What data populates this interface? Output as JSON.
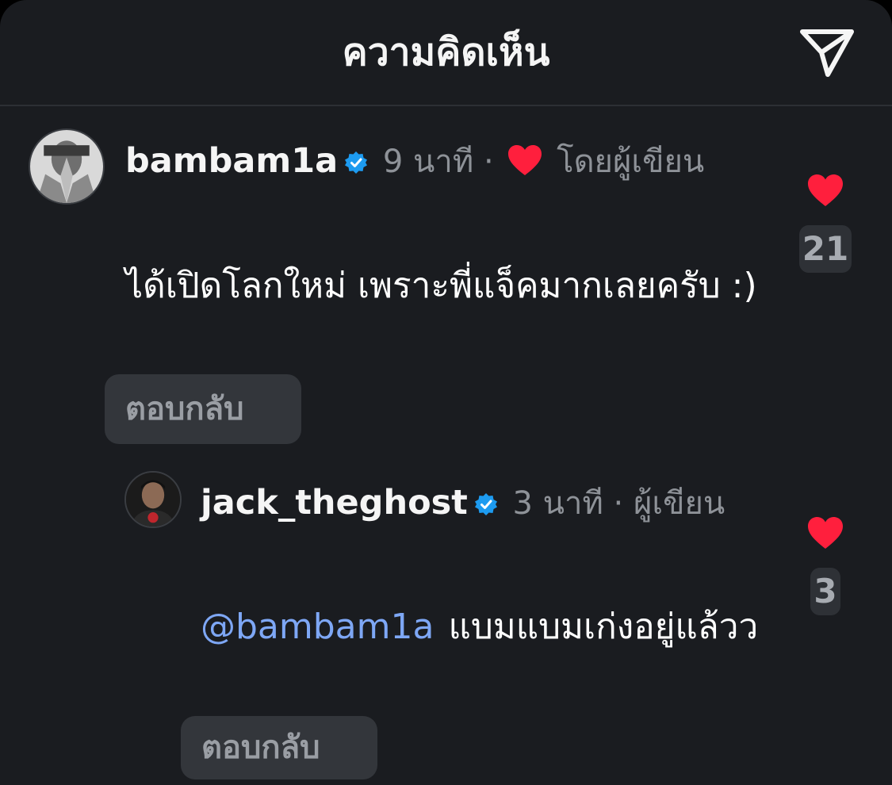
{
  "header": {
    "title": "ความคิดเห็น",
    "share_icon": "paper-plane-icon"
  },
  "colors": {
    "background": "#1a1c20",
    "verified": "#1d9bf0",
    "like": "#ff1f3d",
    "mention": "#7ea7f5"
  },
  "comments": [
    {
      "username": "bambam1a",
      "verified": true,
      "time": "9 นาที",
      "separator": "·",
      "author_liked_label": "โดยผู้เขียน",
      "text": "ได้เปิดโลกใหม่ เพราะพี่แจ็คมากเลยครับ :)",
      "reply_label": "ตอบกลับ",
      "like_count": "21"
    }
  ],
  "replies": [
    {
      "username": "jack_theghost",
      "verified": true,
      "time": "3 นาที",
      "separator": "·",
      "author_label": "ผู้เขียน",
      "mention": "@bambam1a",
      "text": "แบมแบมเก่งอยู่แล้วว",
      "reply_label": "ตอบกลับ",
      "like_count": "3"
    }
  ]
}
